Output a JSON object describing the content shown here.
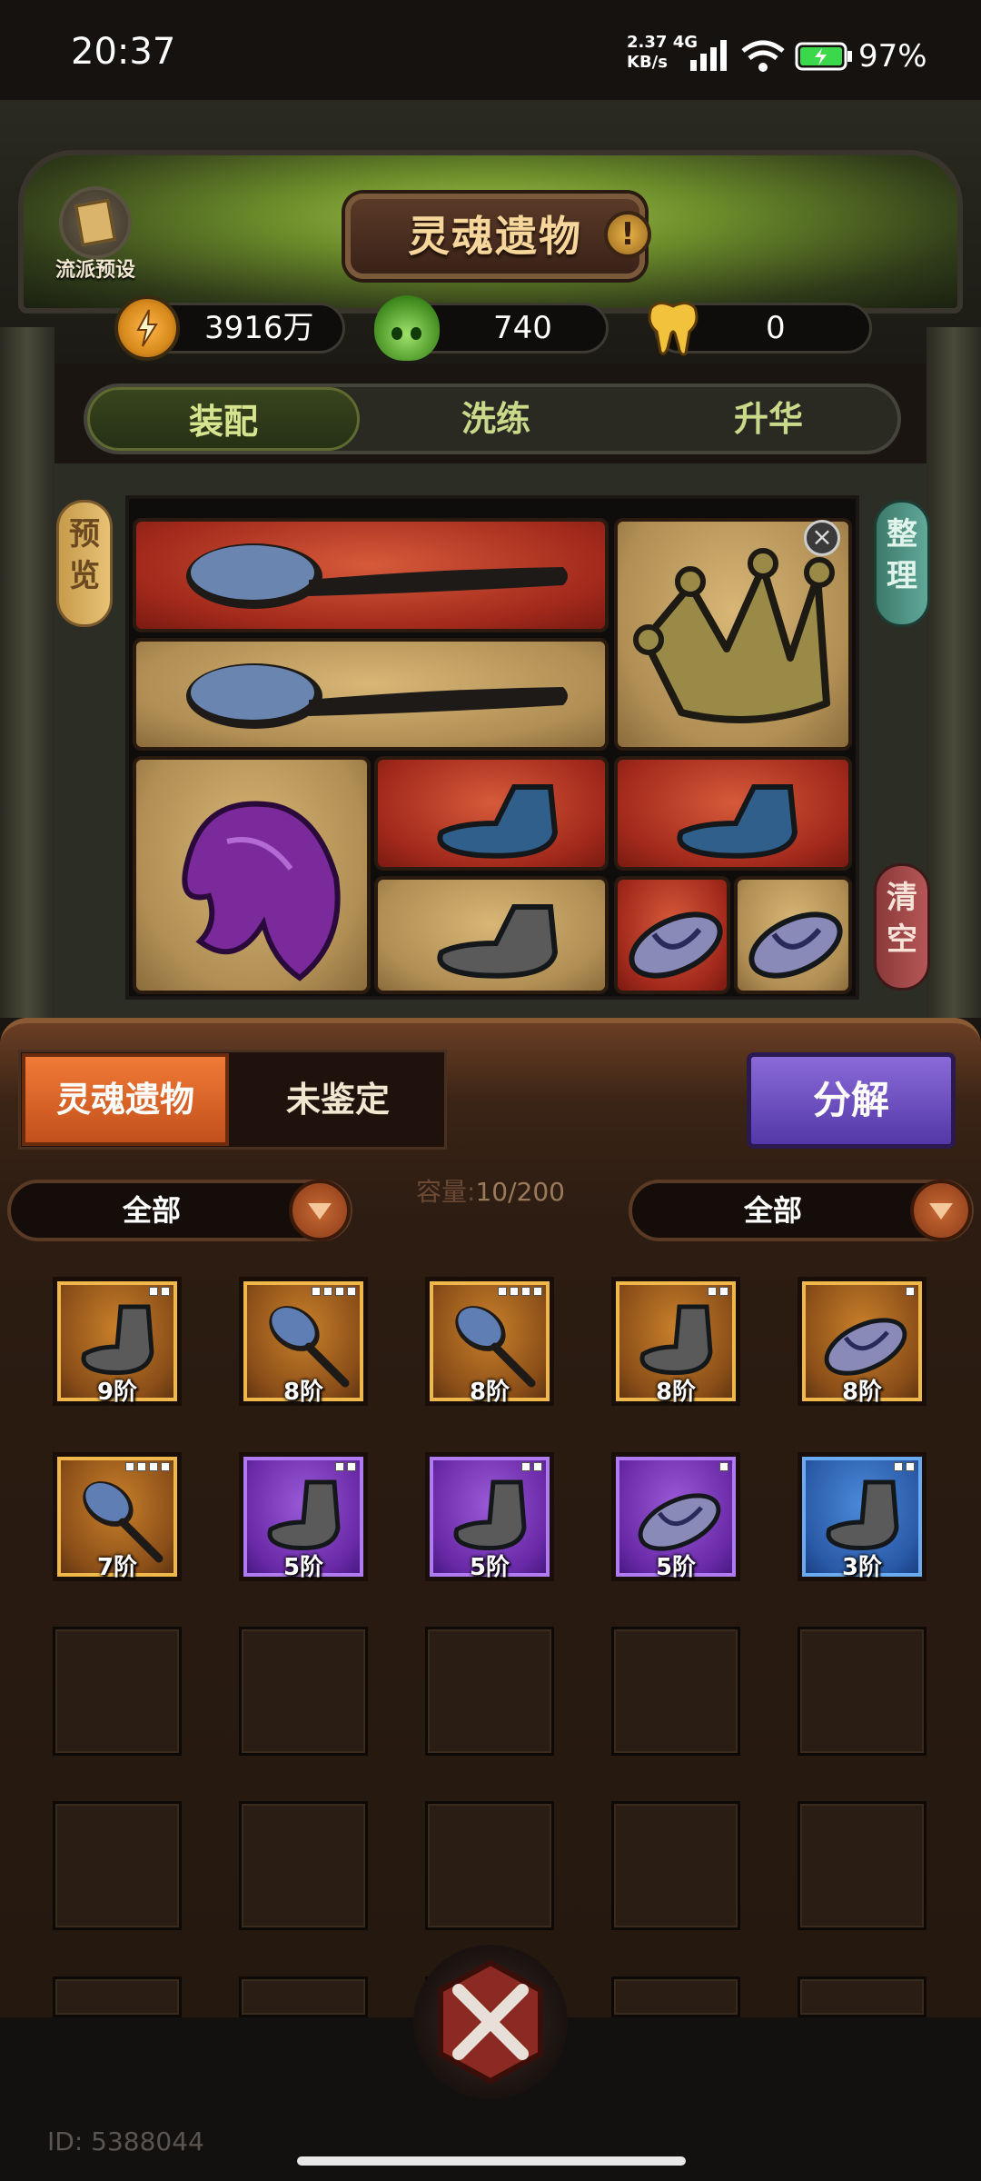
{
  "status_bar": {
    "time": "20:37",
    "net_speed_value": "2.37",
    "net_type": "4G",
    "net_unit": "KB/s",
    "battery": "97%"
  },
  "header": {
    "preset_label": "流派预设",
    "title": "灵魂遗物",
    "info_glyph": "!"
  },
  "currency": {
    "gold": "3916万",
    "soul": "740",
    "tooth": "0"
  },
  "tabs": [
    {
      "label": "装配"
    },
    {
      "label": "洗练"
    },
    {
      "label": "升华"
    }
  ],
  "equip_panel": {
    "preview_label": "预览",
    "sort_label": "整理",
    "clear_label": "清空",
    "close_glyph": "×"
  },
  "inventory": {
    "switch_relic": "灵魂遗物",
    "switch_unidentified": "未鉴定",
    "decompose_label": "分解",
    "capacity_label": "容量:",
    "capacity_value": "10/200",
    "filter_left": "全部",
    "filter_right": "全部",
    "items": [
      {
        "icon": "sock-icon",
        "tier": "9阶",
        "rarity": "gold",
        "dots": 2
      },
      {
        "icon": "brush-icon",
        "tier": "8阶",
        "rarity": "gold",
        "dots": 4
      },
      {
        "icon": "brush-icon",
        "tier": "8阶",
        "rarity": "gold",
        "dots": 4
      },
      {
        "icon": "sock-icon",
        "tier": "8阶",
        "rarity": "gold",
        "dots": 2
      },
      {
        "icon": "slipper-icon",
        "tier": "8阶",
        "rarity": "gold",
        "dots": 1
      },
      {
        "icon": "brush-icon",
        "tier": "7阶",
        "rarity": "gold",
        "dots": 4
      },
      {
        "icon": "sock-icon",
        "tier": "5阶",
        "rarity": "purple",
        "dots": 2
      },
      {
        "icon": "sock-icon",
        "tier": "5阶",
        "rarity": "purple",
        "dots": 2
      },
      {
        "icon": "slipper-icon",
        "tier": "5阶",
        "rarity": "purple",
        "dots": 1
      },
      {
        "icon": "sock-icon",
        "tier": "3阶",
        "rarity": "blue",
        "dots": 2
      }
    ]
  },
  "footer": {
    "account_id": "ID: 5388044"
  },
  "colors": {
    "gold_rarity": "#c9802a",
    "purple_rarity": "#6a2aa8",
    "blue_rarity": "#2a5aa8",
    "red_slot": "#a32a1c",
    "tan_slot": "#b08e54",
    "accent_tab": "#d7e48f"
  }
}
